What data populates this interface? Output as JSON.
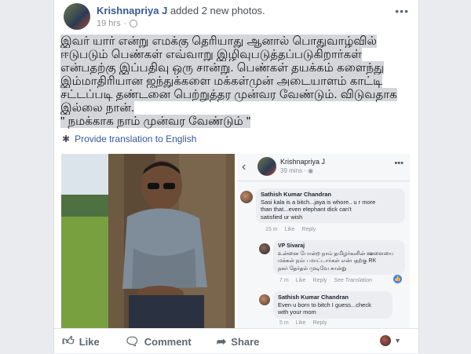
{
  "post": {
    "author": "Krishnapriya J",
    "action": "added 2 new photos.",
    "time": "19 hrs",
    "more_label": "•••",
    "lines": [
      "இவர் யார் என்று எமக்கு தெரியாது  ஆனால் பொதுவாழ்வில்",
      "ஈடுபடும் பெண்கள் எவ்வாறு இழிவுபடுத்தப்படுகிறார்கள்",
      "என்பதற்கு இப்பதிவு ஒரு சான்று. பெண்கள் தயக்கம் களைந்து",
      "இம்மாதிரியான ஜந்துக்களை மக்கள்முன் அடையாளம் காட்டி",
      "சட்டப்படி தண்டனை பெற்றுத்தர முன்வர வேண்டும். விடுவதாக",
      "இல்லை நான்.",
      "\" நமக்காக நாம் முன்வர வேண்டும் \""
    ],
    "translate_label": "Provide translation to English"
  },
  "inner": {
    "name": "Krishnapriya J",
    "time": "39 mins · ",
    "comments": [
      {
        "name": "Sathish Kumar Chandran",
        "text": [
          "Sasi kala is a bitch...jaya is whore.. u r more",
          "than that...even elephant dick can't",
          "satisfied ur wish"
        ],
        "time": "15 m",
        "like": "Like",
        "reply": "Reply"
      },
      {
        "name": "VP Sivaraj",
        "text": [
          "உன்னை போன்ற நாம் தமிழர்களின் ஊளையை",
          "மக்கள் நம்ப மாட்டார்கள் என்பதற்கு RK",
          "நகர் தேர்தல் முடிவே சான்று"
        ],
        "time": "7 m",
        "like": "Like",
        "reply": "Reply",
        "translation": "See Translation"
      },
      {
        "name": "Sathish Kumar Chandran",
        "text": [
          "Even u born to bitch I guess...check",
          "with your mom"
        ],
        "time": "5 m",
        "like": "Like",
        "reply": "Reply"
      }
    ]
  },
  "actions": {
    "like": "Like",
    "comment": "Comment",
    "share": "Share"
  },
  "colors": {
    "link": "#365899",
    "highlight": "#d4d6da",
    "bubble": "#ebedf0"
  }
}
